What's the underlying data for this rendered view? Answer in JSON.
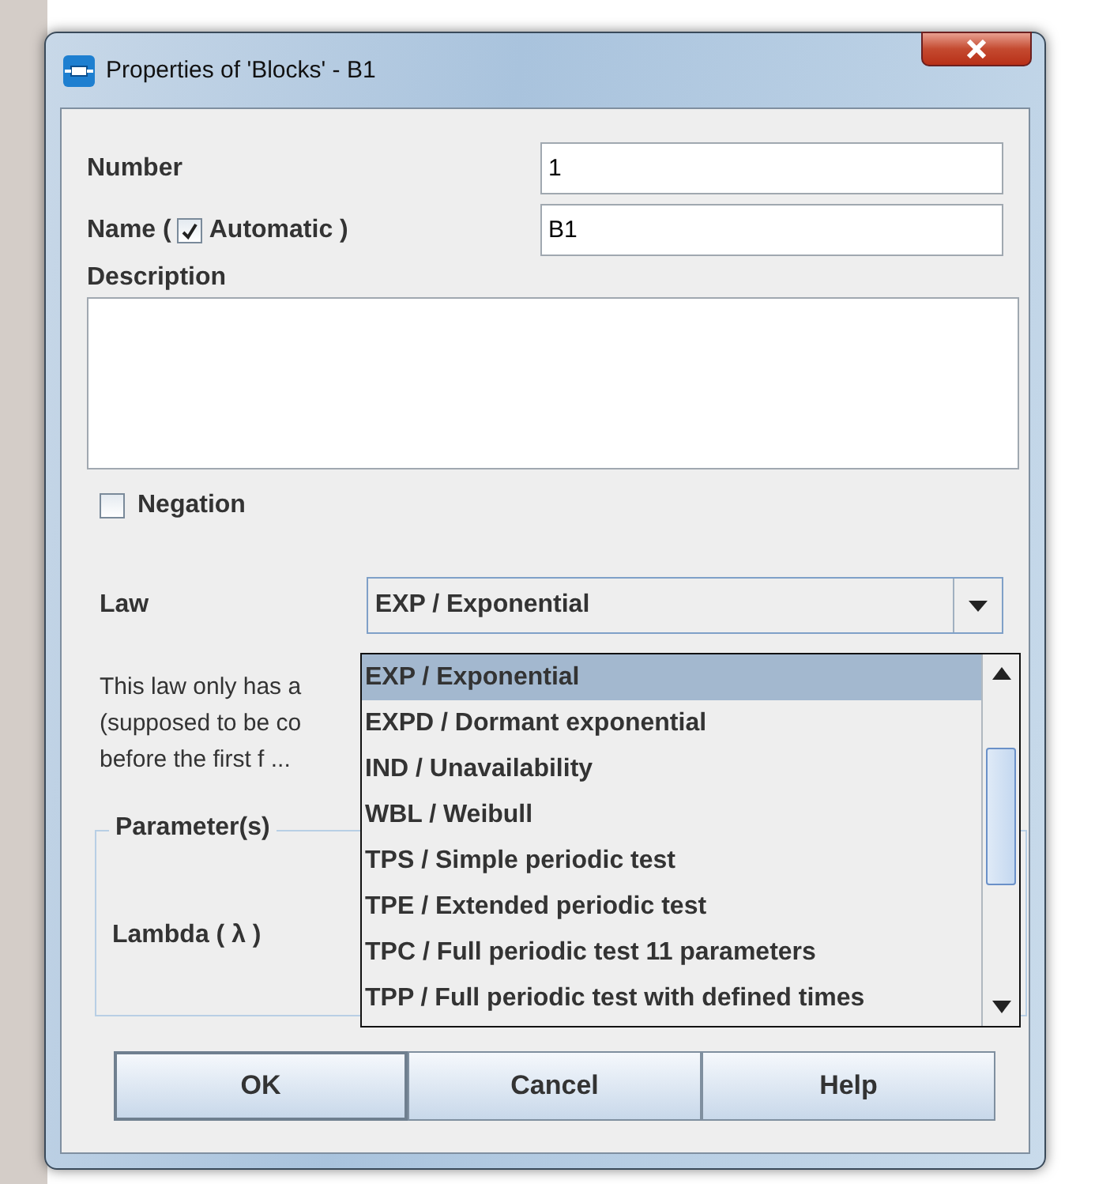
{
  "window": {
    "title": "Properties of 'Blocks' - B1"
  },
  "fields": [
    {
      "label": "Number",
      "value": "1"
    },
    {
      "label_before": "Name (",
      "label_after": "Automatic )",
      "checked": true,
      "value": "B1"
    }
  ],
  "description": {
    "label": "Description"
  },
  "negation": {
    "label": "Negation",
    "checked": false
  },
  "law": {
    "label": "Law",
    "value": "EXP / Exponential"
  },
  "law_description": [
    "This law only has a",
    "(supposed to be co",
    "before the first f ..."
  ],
  "parameters": {
    "title": "Parameter(s)",
    "rows": [
      {
        "label": "Lambda ( λ )"
      }
    ]
  },
  "law_options": [
    {
      "label": "EXP / Exponential",
      "selected": true
    },
    {
      "label": "EXPD / Dormant exponential",
      "selected": false
    },
    {
      "label": "IND / Unavailability",
      "selected": false
    },
    {
      "label": "WBL / Weibull",
      "selected": false
    },
    {
      "label": "TPS / Simple periodic test",
      "selected": false
    },
    {
      "label": "TPE / Extended periodic test",
      "selected": false
    },
    {
      "label": "TPC / Full periodic test 11 parameters",
      "selected": false
    },
    {
      "label": "TPP / Full periodic test with defined times",
      "selected": false
    }
  ],
  "buttons": [
    {
      "label": "OK",
      "kind": "default"
    },
    {
      "label": "Cancel",
      "kind": "normal"
    },
    {
      "label": "Help",
      "kind": "normal"
    }
  ]
}
